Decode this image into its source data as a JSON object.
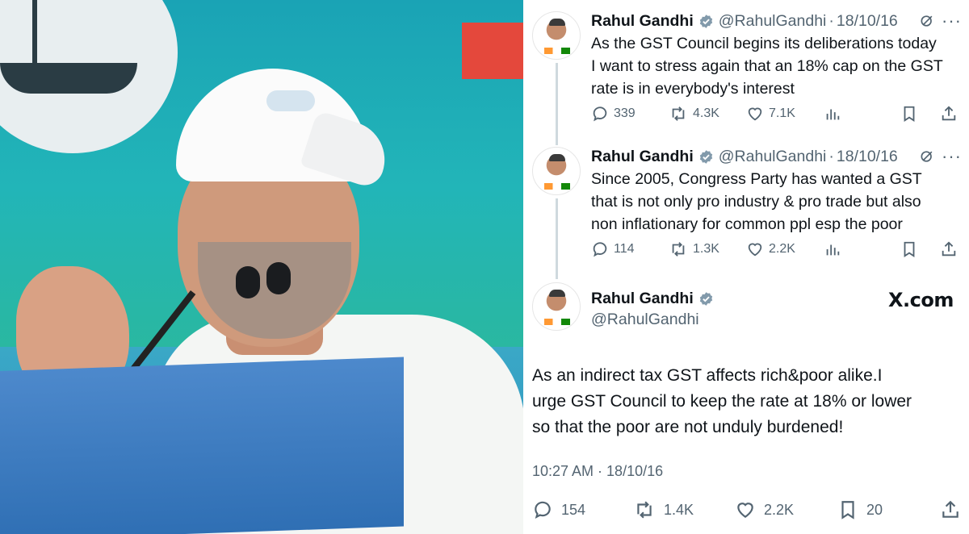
{
  "tweets": [
    {
      "name": "Rahul Gandhi",
      "handle": "@RahulGandhi",
      "date": "18/10/16",
      "text": "As the GST Council begins its deliberations today\nI want to stress again that an 18% cap on the GST\nrate is in everybody's interest",
      "replies": "339",
      "reposts": "4.3K",
      "likes": "7.1K"
    },
    {
      "name": "Rahul Gandhi",
      "handle": "@RahulGandhi",
      "date": "18/10/16",
      "text": "Since 2005, Congress Party has  wanted a GST\nthat is not only pro industry & pro trade but also\nnon inflationary for common ppl esp the poor",
      "replies": "114",
      "reposts": "1.3K",
      "likes": "2.2K"
    }
  ],
  "main_tweet": {
    "name": "Rahul Gandhi",
    "handle": "@RahulGandhi",
    "site": "X.com",
    "text": "As an indirect tax GST affects rich&poor alike.I\nurge GST Council to keep the rate at 18% or lower\nso that the poor are not unduly burdened!",
    "timestamp": "10:27 AM · 18/10/16",
    "replies": "154",
    "reposts": "1.4K",
    "likes": "2.2K",
    "bookmarks": "20"
  },
  "colors": {
    "verified": "#829aab",
    "muted": "#536471",
    "text": "#0f1419",
    "thread_line": "#cfd9de"
  },
  "icons": [
    "reply-icon",
    "repost-icon",
    "like-icon",
    "views-icon",
    "bookmark-icon",
    "share-icon",
    "grok-icon",
    "more-icon",
    "verified-icon"
  ]
}
